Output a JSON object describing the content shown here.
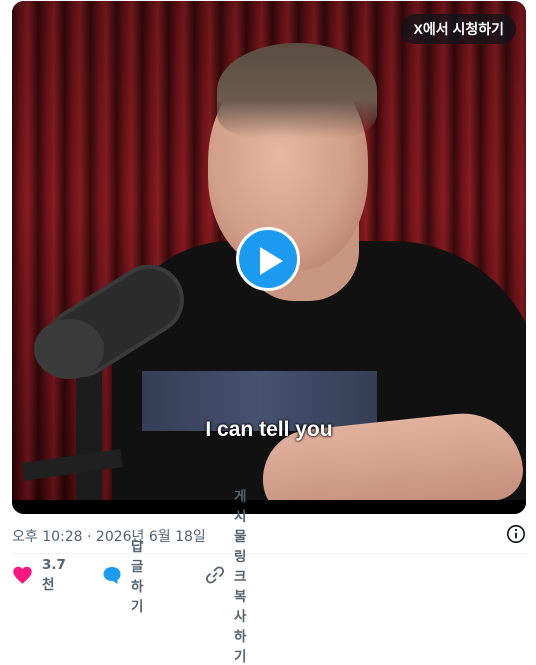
{
  "video": {
    "watch_on_x_label": "X에서 시청하기",
    "caption": "I can tell you",
    "play_icon": "play-icon"
  },
  "meta": {
    "timestamp": "오후 10:28 · 2026년 6월 18일",
    "info_icon": "info-icon"
  },
  "actions": {
    "like": {
      "icon": "heart-icon",
      "count": "3.7천",
      "color": "#f91880"
    },
    "reply": {
      "icon": "speech-bubble-icon",
      "label": "답글하기",
      "color": "#1d9bf0"
    },
    "copy_link": {
      "icon": "link-icon",
      "label": "게시물 링크 복사하기"
    }
  },
  "colors": {
    "accent": "#1d9bf0",
    "muted_text": "#536471"
  }
}
